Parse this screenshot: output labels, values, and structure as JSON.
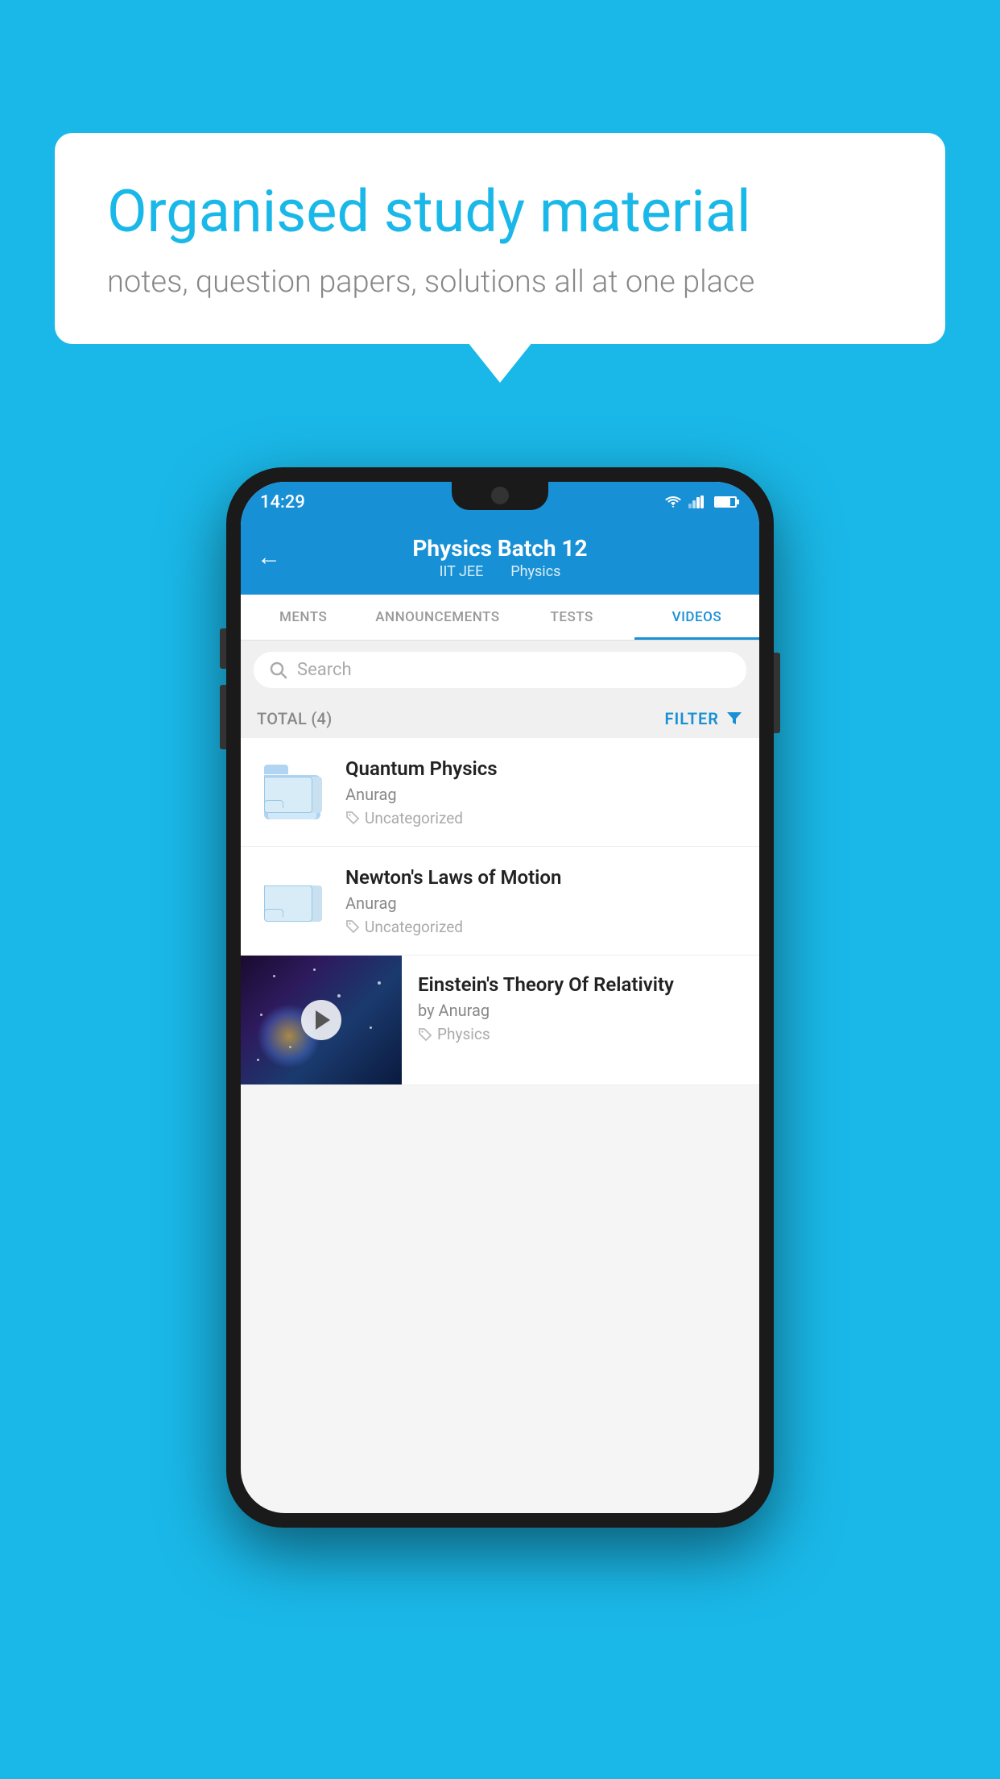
{
  "background_color": "#1ab8e8",
  "speech_bubble": {
    "title": "Organised study material",
    "subtitle": "notes, question papers, solutions all at one place"
  },
  "status_bar": {
    "time": "14:29",
    "wifi": "▾",
    "signal": "▲",
    "battery": "█"
  },
  "app_header": {
    "back_label": "←",
    "title": "Physics Batch 12",
    "subtitle_left": "IIT JEE",
    "subtitle_right": "Physics"
  },
  "tabs": [
    {
      "label": "MENTS",
      "active": false
    },
    {
      "label": "ANNOUNCEMENTS",
      "active": false
    },
    {
      "label": "TESTS",
      "active": false
    },
    {
      "label": "VIDEOS",
      "active": true
    }
  ],
  "search": {
    "placeholder": "Search"
  },
  "filter_row": {
    "total_label": "TOTAL (4)",
    "filter_label": "FILTER"
  },
  "videos": [
    {
      "id": 1,
      "title": "Quantum Physics",
      "author": "Anurag",
      "tag": "Uncategorized",
      "has_thumbnail": false
    },
    {
      "id": 2,
      "title": "Newton's Laws of Motion",
      "author": "Anurag",
      "tag": "Uncategorized",
      "has_thumbnail": false
    },
    {
      "id": 3,
      "title": "Einstein's Theory Of Relativity",
      "author": "by Anurag",
      "tag": "Physics",
      "has_thumbnail": true
    }
  ]
}
